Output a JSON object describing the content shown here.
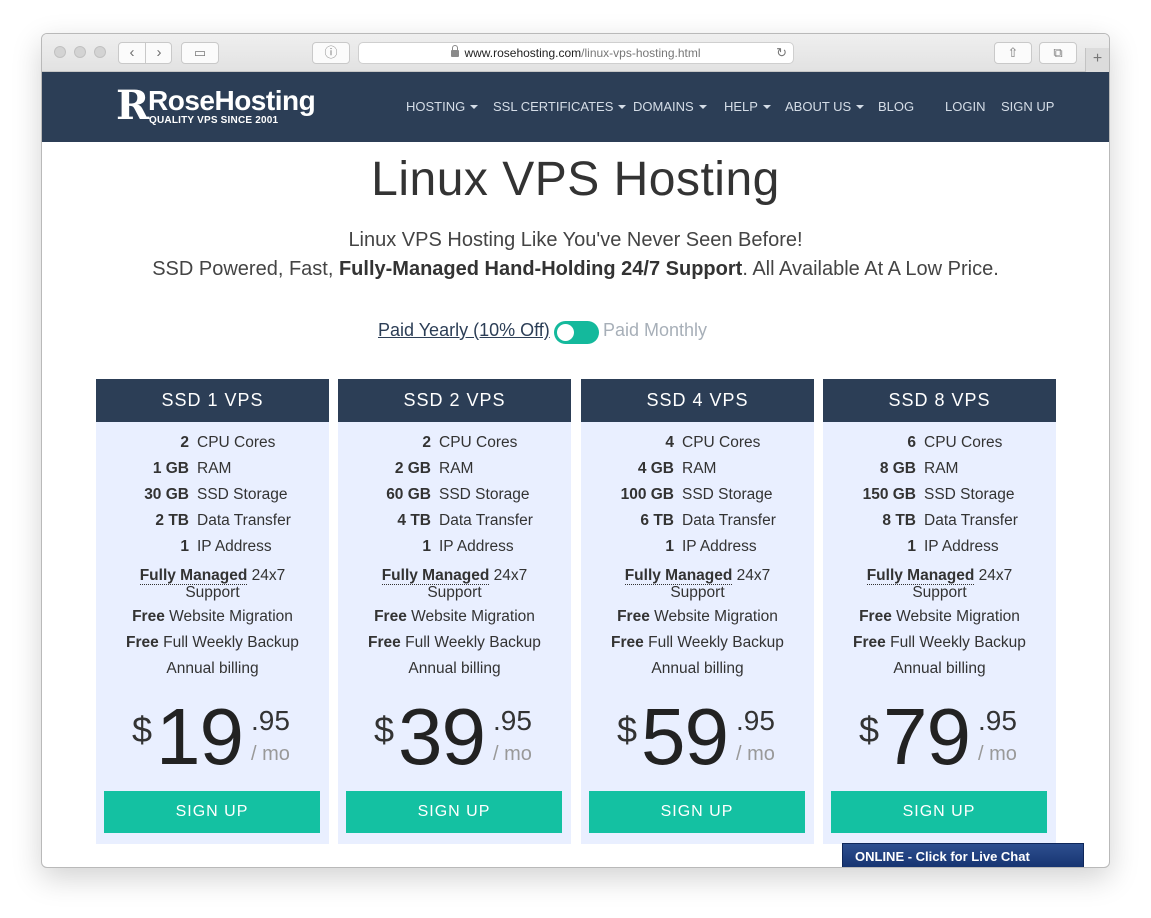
{
  "browser": {
    "url_host": "www.rosehosting.com",
    "url_path": "/linux-vps-hosting.html",
    "new_tab_label": "+"
  },
  "header": {
    "logo_mark": "R",
    "logo_name": "RoseHosting",
    "logo_tagline": "QUALITY VPS SINCE 2001",
    "nav": [
      {
        "label": "HOSTING",
        "dropdown": true
      },
      {
        "label": "SSL CERTIFICATES",
        "dropdown": true
      },
      {
        "label": "DOMAINS",
        "dropdown": true
      },
      {
        "label": "HELP",
        "dropdown": true
      },
      {
        "label": "ABOUT US",
        "dropdown": true
      },
      {
        "label": "BLOG",
        "dropdown": false
      },
      {
        "label": "LOGIN",
        "dropdown": false
      },
      {
        "label": "SIGN UP",
        "dropdown": false
      }
    ]
  },
  "main": {
    "title": "Linux VPS Hosting",
    "subtitle_line1": "Linux VPS Hosting Like You've Never Seen Before!",
    "subtitle_line2_pre": "SSD Powered, Fast, ",
    "subtitle_line2_bold": "Fully-Managed Hand-Holding 24/7 Support",
    "subtitle_line2_post": ". All Available At A Low Price.",
    "billing": {
      "yearly_label": "Paid Yearly (10% Off)",
      "monthly_label": "Paid Monthly",
      "selected": "yearly"
    }
  },
  "plan_labels": {
    "cpu": "CPU Cores",
    "ram": "RAM",
    "storage": "SSD Storage",
    "transfer": "Data Transfer",
    "ip": "IP Address",
    "managed_bold": "Fully Managed",
    "managed_rest": " 24x7",
    "managed_line2": "Support",
    "free": "Free",
    "migration": " Website Migration",
    "backup": " Full Weekly Backup",
    "annual": "Annual billing",
    "currency": "$",
    "per": "/ mo",
    "signup": "SIGN UP"
  },
  "plans": [
    {
      "name": "SSD 1 VPS",
      "cpu": "2",
      "ram": "1 GB",
      "storage": "30 GB",
      "transfer": "2 TB",
      "ip": "1",
      "price_whole": "19",
      "price_cents": ".95"
    },
    {
      "name": "SSD 2 VPS",
      "cpu": "2",
      "ram": "2 GB",
      "storage": "60 GB",
      "transfer": "4 TB",
      "ip": "1",
      "price_whole": "39",
      "price_cents": ".95"
    },
    {
      "name": "SSD 4 VPS",
      "cpu": "4",
      "ram": "4 GB",
      "storage": "100 GB",
      "transfer": "6 TB",
      "ip": "1",
      "price_whole": "59",
      "price_cents": ".95"
    },
    {
      "name": "SSD 8 VPS",
      "cpu": "6",
      "ram": "8 GB",
      "storage": "150 GB",
      "transfer": "8 TB",
      "ip": "1",
      "price_whole": "79",
      "price_cents": ".95"
    }
  ],
  "chat": {
    "label": "ONLINE - Click for Live Chat"
  },
  "colors": {
    "header_bg": "#2c3e56",
    "accent": "#14c1a2",
    "plan_bg": "#e9efff"
  }
}
